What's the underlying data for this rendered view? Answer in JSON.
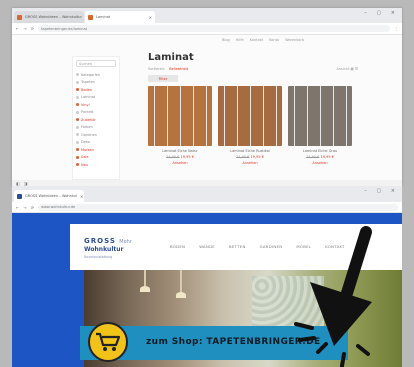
{
  "top_browser": {
    "tabs": [
      {
        "label": "GROSS Wohnideen – Wohnkultur"
      },
      {
        "label": "Laminat"
      }
    ],
    "url": "tapetenbringer.de/laminat"
  },
  "shop": {
    "nav": [
      "Blog",
      "Hilfe",
      "Kontakt",
      "Konto",
      "Warenkorb"
    ],
    "search_placeholder": "Suchen",
    "categories": [
      {
        "label": "Kategorien",
        "highlight": false
      },
      {
        "label": "Tapeten",
        "highlight": false
      },
      {
        "label": "Boden",
        "highlight": true
      },
      {
        "label": "Laminat",
        "highlight": false
      },
      {
        "label": "Vinyl",
        "highlight": true
      },
      {
        "label": "Parkett",
        "highlight": false
      },
      {
        "label": "Zubehör",
        "highlight": true
      },
      {
        "label": "Farben",
        "highlight": false
      },
      {
        "label": "Gardinen",
        "highlight": false
      },
      {
        "label": "Deko",
        "highlight": false
      },
      {
        "label": "Marken",
        "highlight": true
      },
      {
        "label": "Sale",
        "highlight": true
      },
      {
        "label": "Neu",
        "highlight": true
      }
    ],
    "page_title": "Laminat",
    "breadcrumb_prefix": "Sortieren:",
    "breadcrumb_sort": "Beliebtheit",
    "view_options": "Ansicht  ▦  ☰",
    "filter_label": "Filter",
    "products": [
      {
        "name": "Laminat Eiche Natur",
        "old_price": "24,95 €",
        "price": "19,95 €",
        "button": "Ansehen",
        "color": "#b5733f"
      },
      {
        "name": "Laminat Eiche Rustikal",
        "old_price": "24,95 €",
        "price": "19,95 €",
        "button": "Ansehen",
        "color": "#a66c3f"
      },
      {
        "name": "Laminat Eiche Grau",
        "old_price": "24,95 €",
        "price": "19,95 €",
        "button": "Ansehen",
        "color": "#7e766c"
      }
    ]
  },
  "bottom_browser": {
    "tabs": [
      {
        "label": "GROSS Wohnideen – Wohnkul"
      }
    ],
    "url": "www.wohnkultur.de"
  },
  "site": {
    "logo_top": "GROSS",
    "logo_tag": "Mehr",
    "logo_bottom": "Wohnkultur",
    "logo_sub": "Raumausstattung",
    "nav": [
      "BÖDEN",
      "WÄNDE",
      "BETTEN",
      "GARDINEN",
      "MÖBEL",
      "KONTAKT"
    ],
    "banner_text": "zum Shop: TAPETENBRINGER.DE"
  },
  "colors": {
    "site_blue": "#1d56c4",
    "banner_blue": "#1f8fbf",
    "cart_yellow": "#f1c31a",
    "accent_red": "#d9331f"
  }
}
